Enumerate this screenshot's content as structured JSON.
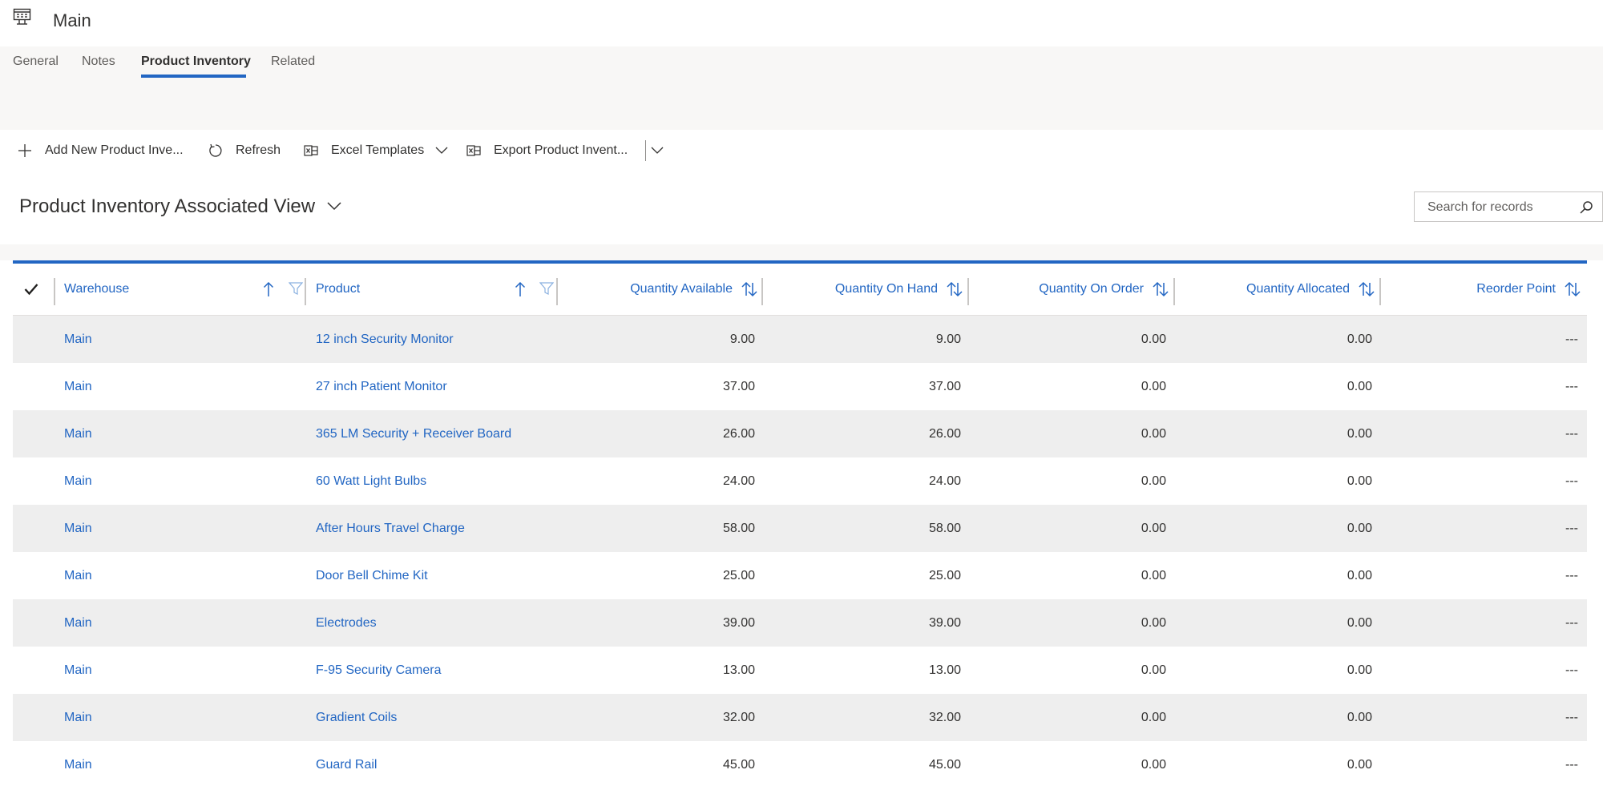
{
  "header": {
    "title": "Main",
    "icon": "entity-grid-icon"
  },
  "tabs": [
    {
      "label": "General"
    },
    {
      "label": "Notes"
    },
    {
      "label": "Product Inventory",
      "active": true
    },
    {
      "label": "Related"
    }
  ],
  "commands": {
    "add_label": "Add New Product Inve...",
    "refresh_label": "Refresh",
    "excel_label": "Excel Templates",
    "export_label": "Export Product Invent..."
  },
  "view": {
    "title": "Product Inventory Associated View",
    "search_placeholder": "Search for records"
  },
  "grid": {
    "columns": [
      "Warehouse",
      "Product",
      "Quantity Available",
      "Quantity On Hand",
      "Quantity On Order",
      "Quantity Allocated",
      "Reorder Point"
    ],
    "rows": [
      {
        "warehouse": "Main",
        "product": "12 inch Security Monitor",
        "available": "9.00",
        "on_hand": "9.00",
        "on_order": "0.00",
        "allocated": "0.00",
        "reorder": "---"
      },
      {
        "warehouse": "Main",
        "product": "27 inch Patient Monitor",
        "available": "37.00",
        "on_hand": "37.00",
        "on_order": "0.00",
        "allocated": "0.00",
        "reorder": "---"
      },
      {
        "warehouse": "Main",
        "product": "365 LM Security + Receiver Board",
        "available": "26.00",
        "on_hand": "26.00",
        "on_order": "0.00",
        "allocated": "0.00",
        "reorder": "---"
      },
      {
        "warehouse": "Main",
        "product": "60 Watt Light Bulbs",
        "available": "24.00",
        "on_hand": "24.00",
        "on_order": "0.00",
        "allocated": "0.00",
        "reorder": "---"
      },
      {
        "warehouse": "Main",
        "product": "After Hours Travel Charge",
        "available": "58.00",
        "on_hand": "58.00",
        "on_order": "0.00",
        "allocated": "0.00",
        "reorder": "---"
      },
      {
        "warehouse": "Main",
        "product": "Door Bell Chime Kit",
        "available": "25.00",
        "on_hand": "25.00",
        "on_order": "0.00",
        "allocated": "0.00",
        "reorder": "---"
      },
      {
        "warehouse": "Main",
        "product": "Electrodes",
        "available": "39.00",
        "on_hand": "39.00",
        "on_order": "0.00",
        "allocated": "0.00",
        "reorder": "---"
      },
      {
        "warehouse": "Main",
        "product": "F-95 Security Camera",
        "available": "13.00",
        "on_hand": "13.00",
        "on_order": "0.00",
        "allocated": "0.00",
        "reorder": "---"
      },
      {
        "warehouse": "Main",
        "product": "Gradient Coils",
        "available": "32.00",
        "on_hand": "32.00",
        "on_order": "0.00",
        "allocated": "0.00",
        "reorder": "---"
      },
      {
        "warehouse": "Main",
        "product": "Guard Rail",
        "available": "45.00",
        "on_hand": "45.00",
        "on_order": "0.00",
        "allocated": "0.00",
        "reorder": "---"
      }
    ]
  },
  "colors": {
    "accent": "#2266c3",
    "alt_row": "#eeeeee",
    "band": "#f8f7f6"
  }
}
